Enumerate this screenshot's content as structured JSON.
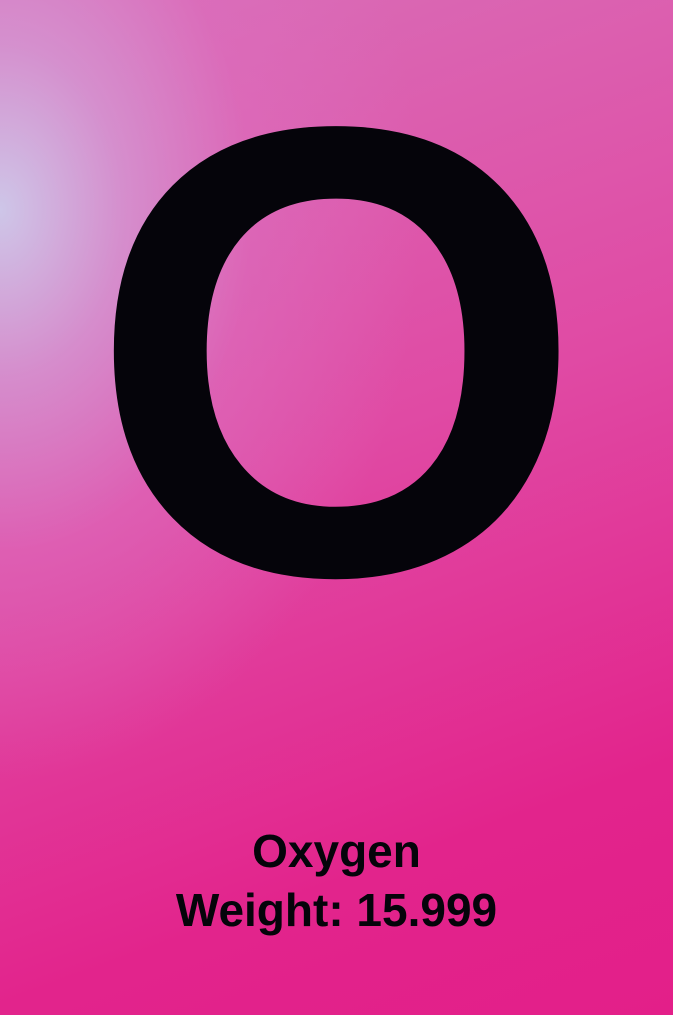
{
  "element": {
    "symbol": "O",
    "name": "Oxygen",
    "weight_label": "Weight: 15.999"
  },
  "colors": {
    "text": "#05040a",
    "background_top_left": "#cec6e8",
    "background_main": "#e31f89"
  }
}
